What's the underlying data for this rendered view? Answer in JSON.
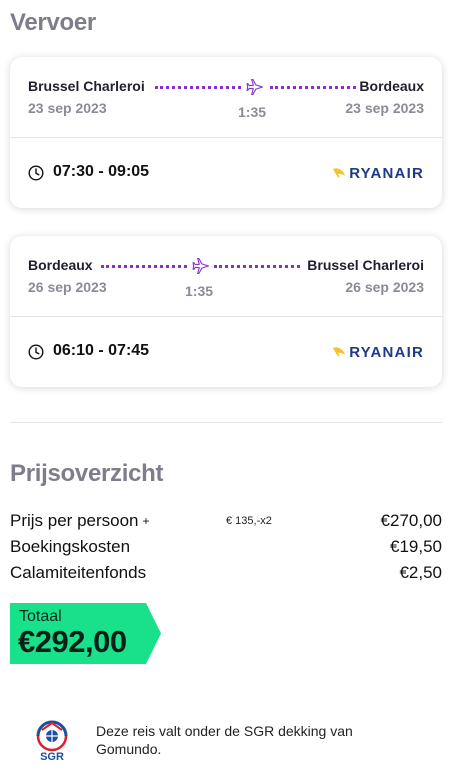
{
  "sections": {
    "transport_title": "Vervoer",
    "price_title": "Prijsoverzicht"
  },
  "flights": [
    {
      "from_city": "Brussel Charleroi",
      "to_city": "Bordeaux",
      "from_date": "23 sep 2023",
      "to_date": "23 sep 2023",
      "duration": "1:35",
      "times": "07:30 - 09:05",
      "airline": "RYANAIR"
    },
    {
      "from_city": "Bordeaux",
      "to_city": "Brussel Charleroi",
      "from_date": "26 sep 2023",
      "to_date": "26 sep 2023",
      "duration": "1:35",
      "times": "06:10 - 07:45",
      "airline": "RYANAIR"
    }
  ],
  "prices": {
    "per_person_label": "Prijs per persoon",
    "per_person_plus": "+",
    "per_person_detail": "€ 135,-x2",
    "per_person_amount": "€270,00",
    "booking_label": "Boekingskosten",
    "booking_amount": "€19,50",
    "calamity_label": "Calamiteitenfonds",
    "calamity_amount": "€2,50"
  },
  "total": {
    "label": "Totaal",
    "amount": "€292,00"
  },
  "sgr": {
    "logo_text": "SGR",
    "text": "Deze reis valt onder de SGR dekking van Gomundo."
  },
  "colors": {
    "route_dots": "#8a2fc9",
    "total_badge": "#19e08a",
    "airline_blue": "#1d3a8a",
    "airline_gold": "#f2c230"
  },
  "icons": {
    "plane": "plane-icon",
    "clock": "clock-icon",
    "airline_logo": "ryanair-harp-icon",
    "sgr_logo": "sgr-globe-icon"
  }
}
